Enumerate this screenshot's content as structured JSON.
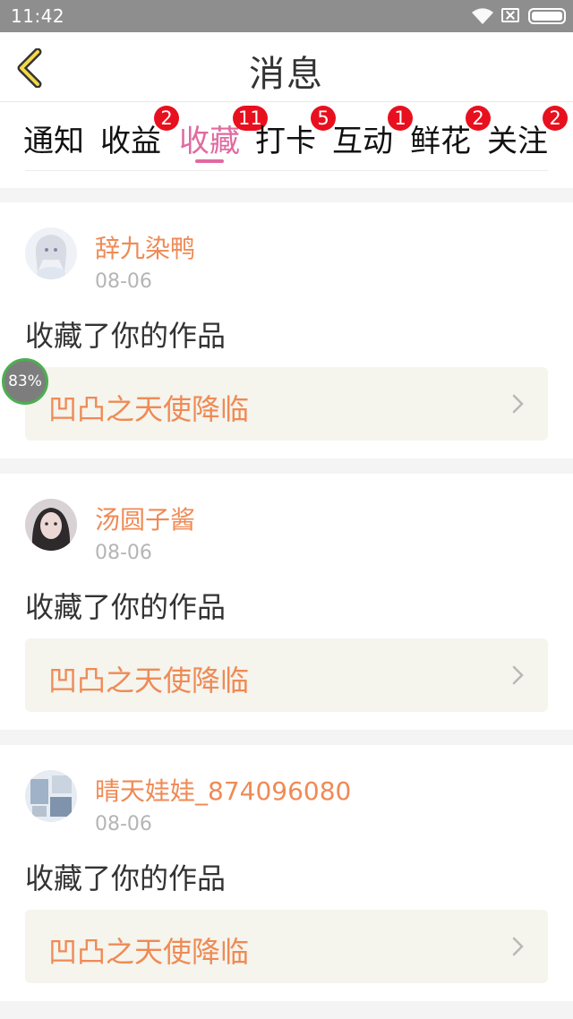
{
  "status_bar": {
    "time": "11:42"
  },
  "header": {
    "title": "消息"
  },
  "tabs": [
    {
      "label": "通知",
      "badge": ""
    },
    {
      "label": "收益",
      "badge": "2"
    },
    {
      "label": "收藏",
      "badge": "11",
      "active": true
    },
    {
      "label": "打卡",
      "badge": "5"
    },
    {
      "label": "互动",
      "badge": "1"
    },
    {
      "label": "鲜花",
      "badge": "2"
    },
    {
      "label": "关注",
      "badge": "2"
    }
  ],
  "messages": [
    {
      "username": "辞九染鸭",
      "date": "08-06",
      "action": "收藏了你的作品",
      "work_title": "凹凸之天使降临"
    },
    {
      "username": "汤圆子酱",
      "date": "08-06",
      "action": "收藏了你的作品",
      "work_title": "凹凸之天使降临"
    },
    {
      "username": "晴天娃娃_874096080",
      "date": "08-06",
      "action": "收藏了你的作品",
      "work_title": "凹凸之天使降临"
    }
  ],
  "overlay": {
    "progress_text": "83%",
    "progress": 0.83
  },
  "colors": {
    "accent_pink": "#e06aa0",
    "accent_orange": "#ef8a55",
    "badge_red": "#e8101e"
  }
}
